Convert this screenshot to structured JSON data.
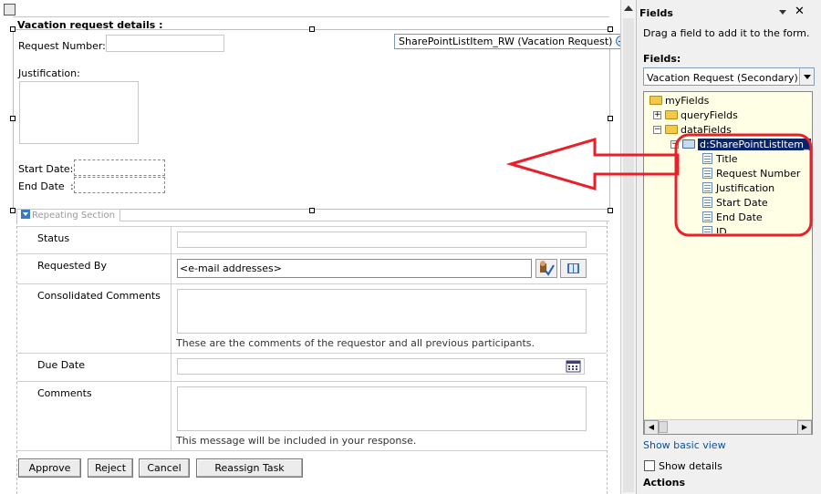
{
  "canvas": {
    "section_title": "Vacation request details :",
    "datasource_tag": "SharePointListItem_RW (Vacation Request)",
    "labels": {
      "request_number": "Request Number:",
      "justification": "Justification:",
      "start_date": "Start Date:",
      "end_date": "End Date",
      "end_date_colon": ":"
    },
    "repeating_section_label": "Repeating Section"
  },
  "task_form": {
    "rows": {
      "status": "Status",
      "requested_by": "Requested By",
      "requested_by_value": "<e-mail addresses>",
      "consolidated_comments": "Consolidated Comments",
      "consolidated_hint": "These are the comments of the requestor and all previous participants.",
      "due_date": "Due Date",
      "comments": "Comments",
      "comments_hint": "This message will be included in your response."
    },
    "buttons": {
      "approve": "Approve",
      "reject": "Reject",
      "cancel": "Cancel",
      "reassign": "Reassign Task"
    }
  },
  "fields_pane": {
    "title": "Fields",
    "instruction": "Drag a field to add it to the form.",
    "fields_label": "Fields:",
    "datasource_select": "Vacation Request (Secondary)",
    "tree": {
      "root": "myFields",
      "query": "queryFields",
      "data": "dataFields",
      "item": "d:SharePointListItem_",
      "children": [
        "Title",
        "Request Number",
        "Justification",
        "Start Date",
        "End Date",
        "ID"
      ]
    },
    "show_basic_view": "Show basic view",
    "show_details": "Show details",
    "actions": "Actions"
  },
  "annotation": {
    "arrow_color": "#e8202a",
    "highlight_color": "#e8202a"
  },
  "colors": {
    "selected_bg": "#0a246a",
    "tree_bg": "#ffffe6",
    "link": "#0b4f9c"
  }
}
